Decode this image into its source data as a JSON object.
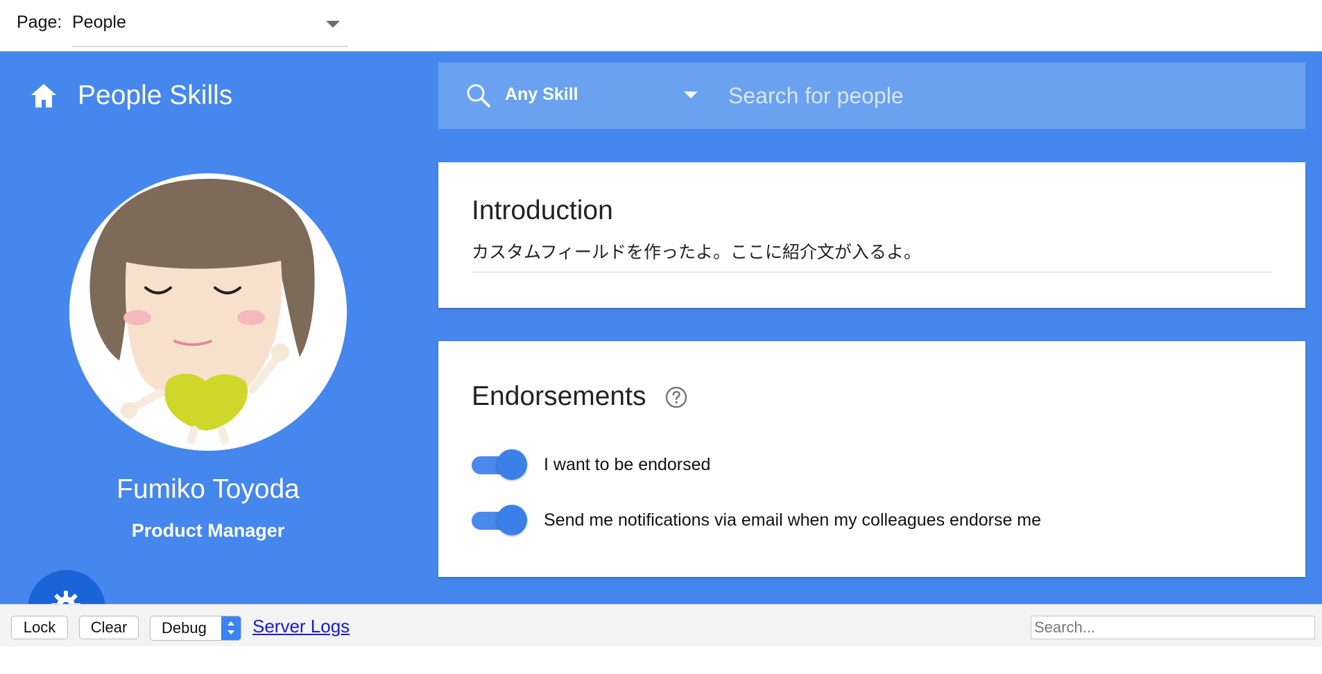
{
  "page_selector": {
    "label": "Page:",
    "value": "People"
  },
  "app": {
    "title": "People Skills",
    "home_icon": "home-icon",
    "colors": {
      "primary": "#4687ed",
      "search_bar": "#6aa2f0",
      "toggle": "#3b7fe9",
      "fab": "#1a64d8"
    }
  },
  "search": {
    "icon": "search-icon",
    "skill_filter": "Any Skill",
    "placeholder": "Search for people"
  },
  "profile": {
    "name": "Fumiko Toyoda",
    "role": "Product Manager",
    "settings_icon": "gear-icon"
  },
  "introduction": {
    "title": "Introduction",
    "text": "カスタムフィールドを作ったよ。ここに紹介文が入るよ。"
  },
  "endorsements": {
    "title": "Endorsements",
    "help_icon": "help-circle-icon",
    "toggles": [
      {
        "label": "I want to be endorsed",
        "checked": true
      },
      {
        "label": "Send me notifications via email when my colleagues endorse me",
        "checked": true
      }
    ]
  },
  "debug_bar": {
    "lock_label": "Lock",
    "clear_label": "Clear",
    "level_value": "Debug",
    "server_logs_label": "Server Logs",
    "search_placeholder": "Search..."
  }
}
